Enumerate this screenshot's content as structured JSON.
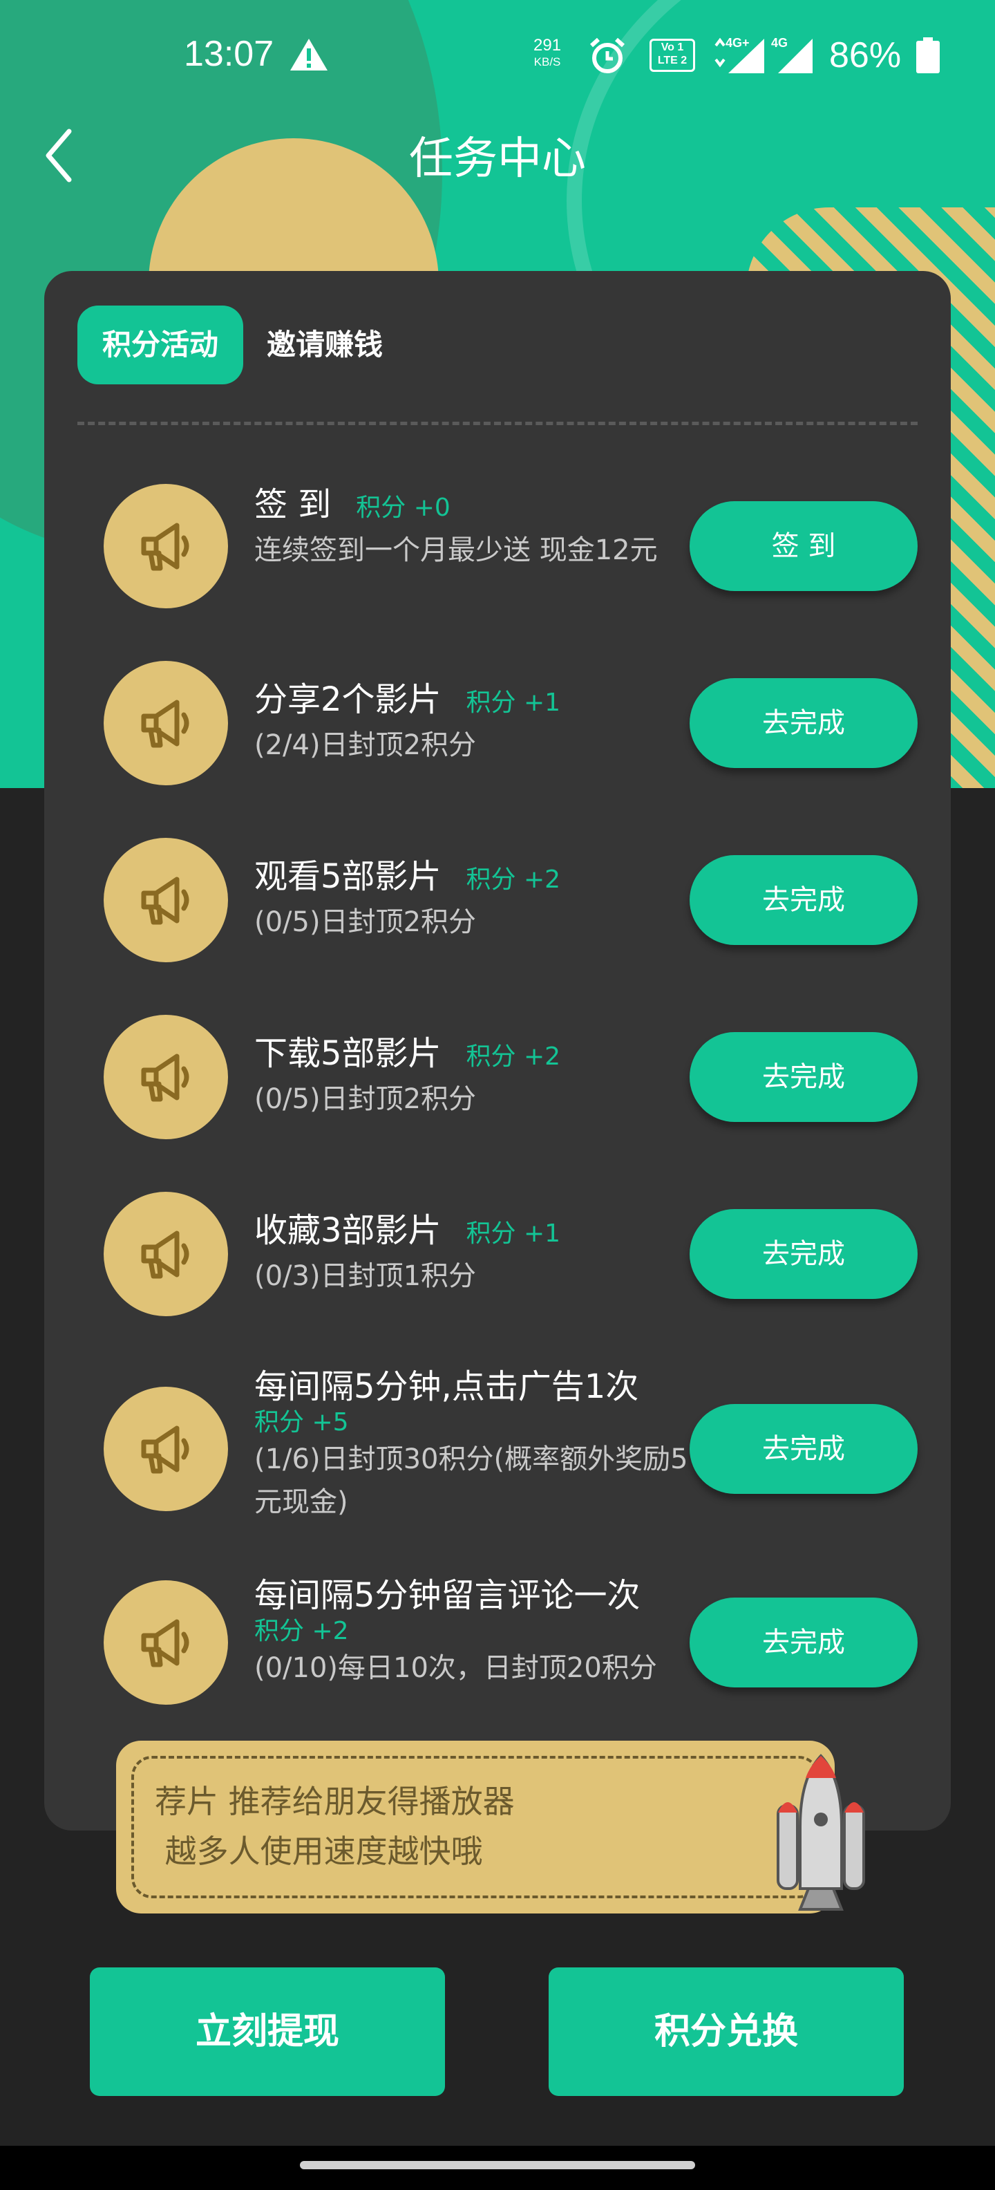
{
  "status_bar": {
    "time": "13:07",
    "net_speed": "291",
    "net_unit": "KB/S",
    "volte_line1": "Vo 1",
    "volte_line2": "LTE 2",
    "sig1_label": "4G+",
    "sig2_label": "4G",
    "battery": "86%"
  },
  "header": {
    "title": "任务中心"
  },
  "tabs": [
    {
      "label": "积分活动",
      "active": true
    },
    {
      "label": "邀请赚钱",
      "active": false
    }
  ],
  "tasks": [
    {
      "name": "签 到",
      "points": "积分 +0",
      "desc": "连续签到一个月最少送 现金12元",
      "button": "签 到"
    },
    {
      "name": "分享2个影片",
      "points": "积分 +1",
      "desc": "(2/4)日封顶2积分",
      "button": "去完成"
    },
    {
      "name": "观看5部影片",
      "points": "积分 +2",
      "desc": "(0/5)日封顶2积分",
      "button": "去完成"
    },
    {
      "name": "下载5部影片",
      "points": "积分 +2",
      "desc": "(0/5)日封顶2积分",
      "button": "去完成"
    },
    {
      "name": "收藏3部影片",
      "points": "积分 +1",
      "desc": "(0/3)日封顶1积分",
      "button": "去完成"
    },
    {
      "name": "每间隔5分钟,点击广告1次",
      "points": "积分 +5",
      "desc": "(1/6)日封顶30积分(概率额外奖励5元现金)",
      "button": "去完成"
    },
    {
      "name": "每间隔5分钟留言评论一次",
      "points": "积分 +2",
      "desc": "(0/10)每日10次，日封顶20积分",
      "button": "去完成"
    }
  ],
  "promo": {
    "line1": "荐片 推荐给朋友得播放器",
    "line2": " 越多人使用速度越快哦"
  },
  "bottom": {
    "withdraw_label": "立刻提现",
    "exchange_label": "积分兑换"
  },
  "colors": {
    "accent": "#13c495",
    "gold": "#e0c377",
    "card": "#363636",
    "background": "#232323"
  }
}
